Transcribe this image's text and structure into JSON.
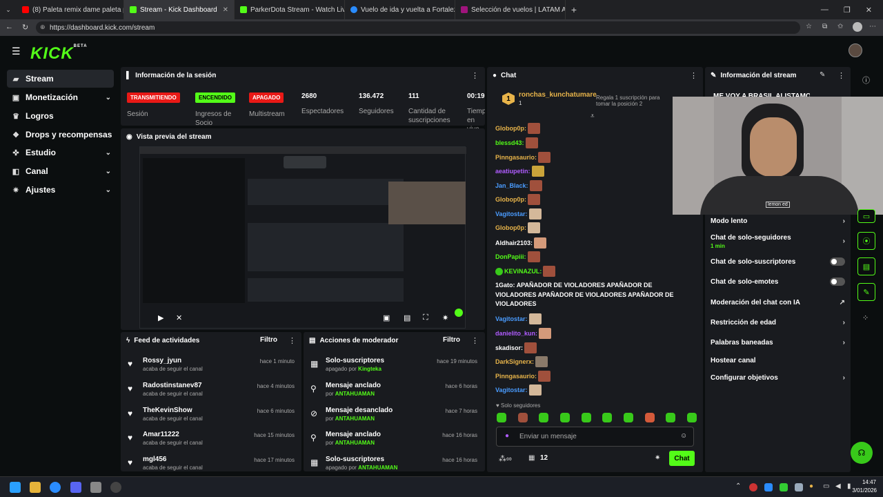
{
  "browser": {
    "tabs": [
      {
        "label": "(8) Paleta remix dame paleta paleta",
        "color": "#ff0000",
        "active": false
      },
      {
        "label": "Stream - Kick Dashboard",
        "color": "#53fc18",
        "active": true
      },
      {
        "label": "ParkerDota Stream - Watch Live on",
        "color": "#53fc18",
        "active": false
      },
      {
        "label": "Vuelo de ida y vuelta a Fortaleza |",
        "color": "#2a8cff",
        "active": false
      },
      {
        "label": "Selección de vuelos | LATAM Airline",
        "color": "#a0147d",
        "active": false
      }
    ],
    "url": "https://dashboard.kick.com/stream"
  },
  "logo": {
    "text": "KICK",
    "sup": "BETA"
  },
  "sidebar": {
    "items": [
      {
        "label": "Stream",
        "icon": "stream-icon",
        "chevron": false,
        "active": true
      },
      {
        "label": "Monetización",
        "icon": "money-icon",
        "chevron": true
      },
      {
        "label": "Logros",
        "icon": "trophy-icon",
        "chevron": false
      },
      {
        "label": "Drops y recompensas",
        "icon": "gift-icon",
        "chevron": false
      },
      {
        "label": "Estudio",
        "icon": "studio-icon",
        "chevron": true
      },
      {
        "label": "Canal",
        "icon": "channel-icon",
        "chevron": true
      },
      {
        "label": "Ajustes",
        "icon": "gear-icon",
        "chevron": true
      }
    ]
  },
  "session": {
    "title": "Información de la sesión",
    "stats": [
      {
        "badge": "TRANSMITIENDO",
        "label": "Sesión",
        "color": "#e91916"
      },
      {
        "badge": "ENCENDIDO",
        "label": "Ingresos de Socio",
        "color": "#53fc18"
      },
      {
        "badge": "APAGADO",
        "label": "Multistream",
        "color": "#e91916"
      },
      {
        "value": "2680",
        "label": "Espectadores"
      },
      {
        "value": "136.472",
        "label": "Seguidores"
      },
      {
        "value": "111",
        "label": "Cantidad de suscripciones"
      },
      {
        "value": "00:19",
        "label": "Tiempo en vivo"
      }
    ]
  },
  "preview": {
    "title": "Vista previa del stream"
  },
  "activity": {
    "title": "Feed de actividades",
    "filter": "Filtro",
    "rows": [
      {
        "name": "Rossy_jyun",
        "sub": "acaba de seguir el canal",
        "time": "hace 1 minuto"
      },
      {
        "name": "Radostinstanev87",
        "sub": "acaba de seguir el canal",
        "time": "hace 4 minutos"
      },
      {
        "name": "TheKevinShow",
        "sub": "acaba de seguir el canal",
        "time": "hace 6 minutos"
      },
      {
        "name": "Amar11222",
        "sub": "acaba de seguir el canal",
        "time": "hace 15 minutos"
      },
      {
        "name": "mgl456",
        "sub": "acaba de seguir el canal",
        "time": "hace 17 minutos"
      }
    ]
  },
  "mod": {
    "title": "Acciones de moderador",
    "filter": "Filtro",
    "rows": [
      {
        "name": "Solo-suscriptores",
        "pre": "apagado por",
        "user": "Kingteka",
        "time": "hace 19 minutos"
      },
      {
        "name": "Mensaje anclado",
        "pre": "por",
        "user": "ANTAHUAMAN",
        "time": "hace 6 horas"
      },
      {
        "name": "Mensaje desanclado",
        "pre": "por",
        "user": "ANTAHUAMAN",
        "time": "hace 7 horas"
      },
      {
        "name": "Mensaje anclado",
        "pre": "por",
        "user": "ANTAHUAMAN",
        "time": "hace 16 horas"
      },
      {
        "name": "Solo-suscriptores",
        "pre": "apagado por",
        "user": "ANTAHUAMAN",
        "time": "hace 16 horas"
      }
    ]
  },
  "chat": {
    "title": "Chat",
    "pinned_user": "ronchas_kunchatumare",
    "pinned_count": "1",
    "gift_text": "Regala 1 suscripción para tomar la posición 2",
    "messages": [
      {
        "user": "Globop0p:",
        "color": "#e8b44a"
      },
      {
        "user": "blessd43:",
        "color": "#53fc18"
      },
      {
        "user": "Pinngasaurio:",
        "color": "#e8b44a"
      },
      {
        "user": "aeatiupetin:",
        "color": "#b05cff"
      },
      {
        "user": "Jan_Black:",
        "color": "#4a9cff"
      },
      {
        "user": "Globop0p:",
        "color": "#e8b44a"
      },
      {
        "user": "Vagitostar:",
        "color": "#4a9cff"
      },
      {
        "user": "Globop0p:",
        "color": "#e8b44a"
      },
      {
        "user": "Aldhair2103:",
        "color": "#ffffff"
      },
      {
        "user": "DonPapiii:",
        "color": "#53fc18"
      },
      {
        "user": "KEViNAZUL:",
        "color": "#53fc18"
      }
    ],
    "long_msg": {
      "user": "1Gato:",
      "text": "APAÑADOR DE VIOLADORES APAÑADOR DE VIOLADORES APAÑADOR DE VIOLADORES APAÑADOR DE VIOLADORES"
    },
    "messages2": [
      {
        "user": "Vagitostar:",
        "color": "#4a9cff"
      },
      {
        "user": "danielito_kun:",
        "color": "#b05cff"
      },
      {
        "user": "skadisor:",
        "color": "#ffffff"
      },
      {
        "user": "DarkSignerx:",
        "color": "#e8b44a"
      },
      {
        "user": "Pinngasaurio:",
        "color": "#e8b44a"
      },
      {
        "user": "Vagitostar:",
        "color": "#4a9cff"
      }
    ],
    "followers_only": "Solo seguidores",
    "input_placeholder": "Enviar un mensaje",
    "viewer_count": "12",
    "send": "Chat"
  },
  "stream_info": {
    "title": "Información del stream",
    "preview_text": "ME VOY A BRASIL ALISTAMOS TODO",
    "settings": [
      {
        "label": "Modo lento",
        "type": "chev"
      },
      {
        "label": "Chat de solo-seguidores",
        "sub": "1 min",
        "type": "chev"
      },
      {
        "label": "Chat de solo-suscriptores",
        "type": "toggle"
      },
      {
        "label": "Chat de solo-emotes",
        "type": "toggle"
      },
      {
        "label": "Moderación del chat con IA",
        "type": "ext"
      },
      {
        "label": "Restricción de edad",
        "type": "chev"
      },
      {
        "label": "Palabras baneadas",
        "type": "chev"
      },
      {
        "label": "Hostear canal",
        "type": "none"
      },
      {
        "label": "Configurar objetivos",
        "type": "chev"
      }
    ]
  },
  "webcam": {
    "shirt_text": "lemon ed"
  },
  "taskbar": {
    "time": "14:47",
    "date": "3/01/2026"
  }
}
